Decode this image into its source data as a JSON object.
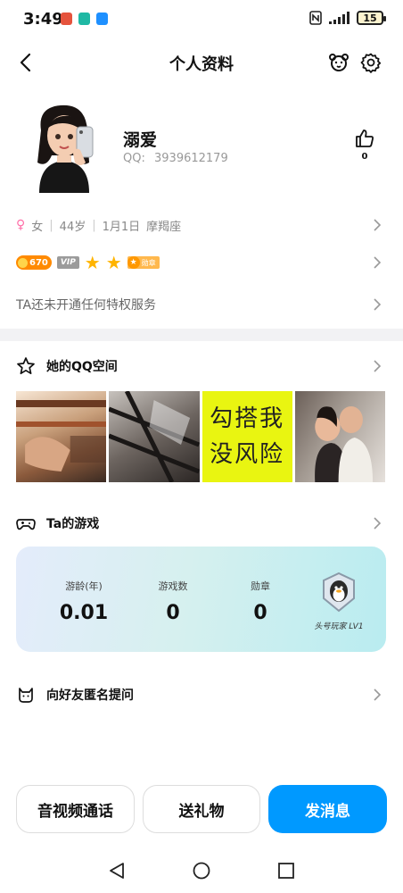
{
  "status_bar": {
    "time": "3:49",
    "battery": "15",
    "app_icons": [
      "#e5533d",
      "#1fb8a4",
      "#1e90ff"
    ]
  },
  "header": {
    "title": "个人资料"
  },
  "profile": {
    "nickname": "溺爱",
    "qq_label": "QQ:",
    "qq_number": "3939612179",
    "like_count": "0"
  },
  "info": {
    "gender": "女",
    "age": "44岁",
    "birthday": "1月1日",
    "zodiac": "摩羯座"
  },
  "badges": {
    "coin": "670",
    "vip": "VIP",
    "stars": 2,
    "medal": "勋章"
  },
  "privilege_text": "TA还未开通任何特权服务",
  "qzone": {
    "title": "她的QQ空间",
    "photo3_text": [
      "勾搭我",
      "没风险"
    ]
  },
  "games": {
    "title": "Ta的游戏",
    "stats": [
      {
        "label": "游龄(年)",
        "value": "0.01"
      },
      {
        "label": "游戏数",
        "value": "0"
      },
      {
        "label": "勋章",
        "value": "0"
      }
    ],
    "level": "头号玩家 LV1"
  },
  "anonymous": {
    "title": "向好友匿名提问"
  },
  "actions": {
    "call": "音视频通话",
    "gift": "送礼物",
    "message": "发消息"
  },
  "colors": {
    "accent": "#0099ff",
    "divider": "#f2f2f4"
  }
}
